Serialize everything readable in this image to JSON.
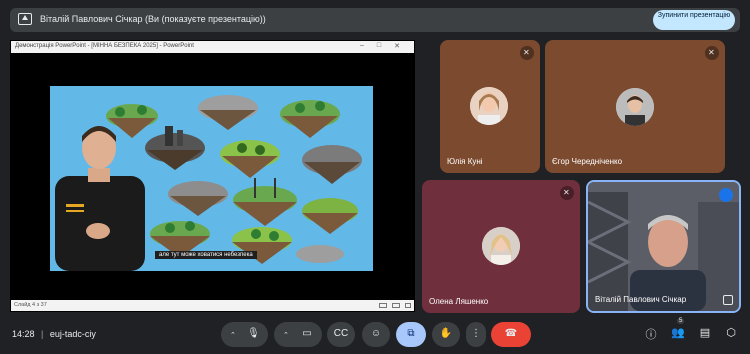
{
  "banner": {
    "text": "Віталій Павлович Січкар (Ви (показуєте презентацію))",
    "stop_button": "Зупинити презентацію",
    "icon": "present-screen-icon"
  },
  "presentation": {
    "window_title": "Демонстрація PowerPoint - [МІННА БЕЗПЕКА 2025] - PowerPoint",
    "caption": "але тут може ховатися небезпека",
    "slide_counter": "Слайд 4 з 37"
  },
  "participants": [
    {
      "name": "Юлія Куні",
      "muted": true
    },
    {
      "name": "Єгор Чередніченко",
      "muted": true
    },
    {
      "name": "Олена Ляшенко",
      "muted": true
    },
    {
      "name": "Віталій Павлович Січкар",
      "speaking": true
    }
  ],
  "bottom_bar": {
    "time": "14:28",
    "meeting_code": "euj-tadc-ciy",
    "people_count": "5",
    "controls": [
      "mic",
      "camera",
      "captions",
      "reactions",
      "present",
      "raise-hand",
      "more",
      "leave"
    ]
  },
  "colors": {
    "background": "#202124",
    "accent_stop": "#c2e7ff",
    "leave_red": "#ea4335",
    "present_active": "#a8c7fa"
  }
}
